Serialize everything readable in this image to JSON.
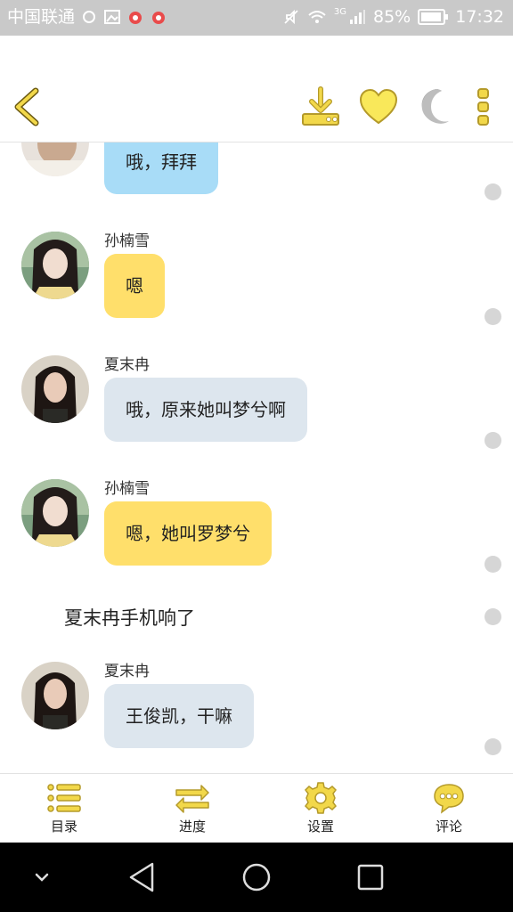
{
  "status_bar": {
    "carrier": "中国联通",
    "network": "3G",
    "battery": "85%",
    "time": "17:32"
  },
  "header": {
    "back_icon": "chevron-left-icon",
    "actions": [
      {
        "name": "download",
        "icon": "download-icon"
      },
      {
        "name": "favorite",
        "icon": "heart-icon"
      },
      {
        "name": "night-mode",
        "icon": "moon-icon"
      },
      {
        "name": "more",
        "icon": "more-vertical-icon"
      }
    ]
  },
  "messages": [
    {
      "type": "chat",
      "sender": "",
      "text": "哦，拜拜",
      "color": "#a8dcf7"
    },
    {
      "type": "chat",
      "sender": "孙楠雪",
      "text": "嗯",
      "color": "#ffdf6b"
    },
    {
      "type": "chat",
      "sender": "夏末冉",
      "text": "哦，原来她叫梦兮啊",
      "color": "#dde6ee"
    },
    {
      "type": "chat",
      "sender": "孙楠雪",
      "text": "嗯，她叫罗梦兮",
      "color": "#ffdf6b"
    },
    {
      "type": "narration",
      "text": "夏末冉手机响了"
    },
    {
      "type": "chat",
      "sender": "夏末冉",
      "text": "王俊凯，干嘛",
      "color": "#dde6ee"
    }
  ],
  "bottom_nav": [
    {
      "label": "目录",
      "icon": "list-icon"
    },
    {
      "label": "进度",
      "icon": "swap-arrows-icon"
    },
    {
      "label": "设置",
      "icon": "gear-icon"
    },
    {
      "label": "评论",
      "icon": "comment-bubble-icon"
    }
  ],
  "colors": {
    "accent": "#f2d84a",
    "accent_stroke": "#b49a2a",
    "bubble_blue": "#a8dcf7",
    "bubble_yellow": "#ffdf6b",
    "bubble_gray": "#dde6ee"
  }
}
